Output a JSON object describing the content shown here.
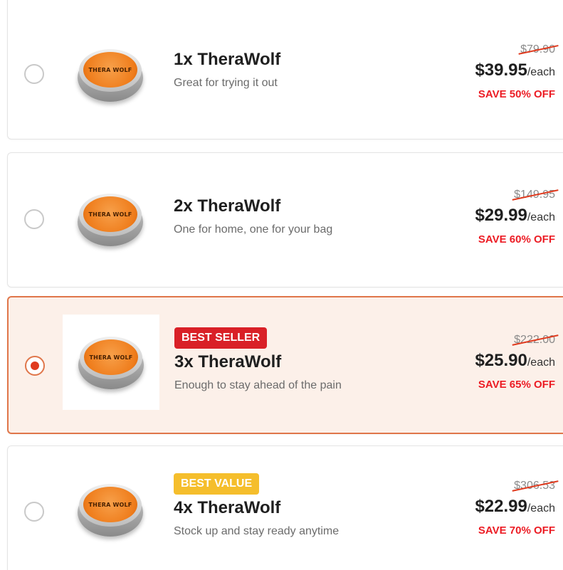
{
  "brand_logo_text": "THERA WOLF",
  "colors": {
    "accent": "#e0764a",
    "selected_bg": "#fcf0e9",
    "save_red": "#ec1c24",
    "badge_red": "#d92027",
    "badge_yellow": "#f5be2c"
  },
  "options": [
    {
      "title": "1x TheraWolf",
      "subtitle": "Great for trying it out",
      "old_price": "$79.90",
      "price": "$39.95",
      "per": "/each",
      "save": "SAVE 50% OFF",
      "selected": false
    },
    {
      "title": "2x TheraWolf",
      "subtitle": "One for home, one for your bag",
      "old_price": "$149.95",
      "price": "$29.99",
      "per": "/each",
      "save": "SAVE 60% OFF",
      "selected": false
    },
    {
      "badge": "BEST SELLER",
      "title": "3x TheraWolf",
      "subtitle": "Enough to stay ahead of the pain",
      "old_price": "$222.00",
      "price": "$25.90",
      "per": "/each",
      "save": "SAVE 65% OFF",
      "selected": true
    },
    {
      "badge": "BEST VALUE",
      "title": "4x TheraWolf",
      "subtitle": "Stock up and stay ready anytime",
      "old_price": "$306.53",
      "price": "$22.99",
      "per": "/each",
      "save": "SAVE 70% OFF",
      "selected": false
    }
  ]
}
